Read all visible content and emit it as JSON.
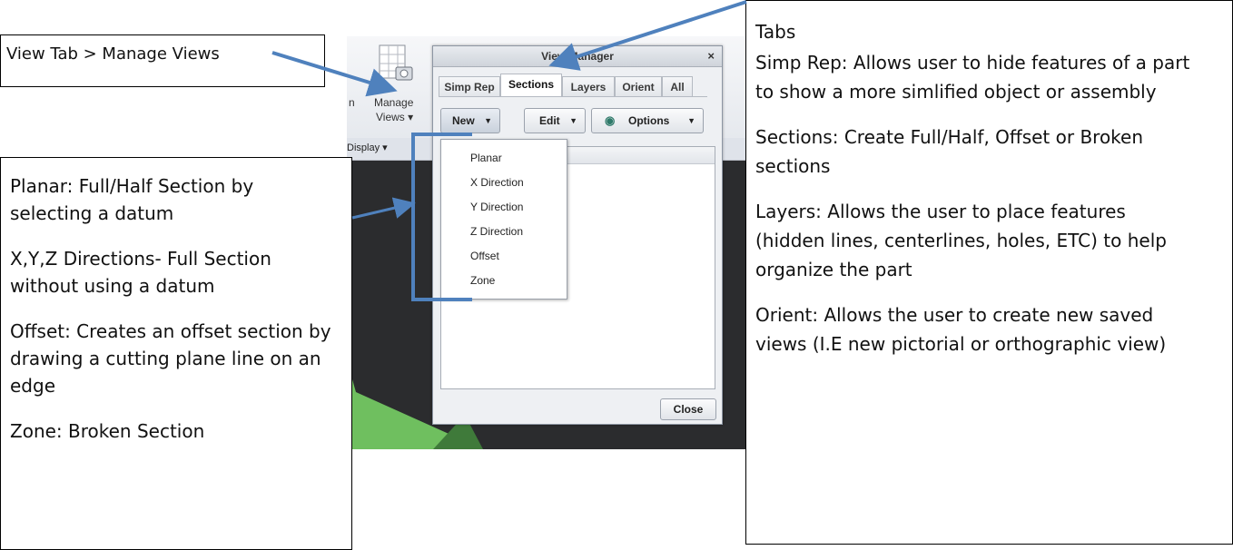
{
  "ribbon": {
    "manage_views_line1": "Manage",
    "manage_views_line2": "Views ▾",
    "partial_left_text": "n",
    "display_label": "Display ▾"
  },
  "view_manager": {
    "title": "View Manager",
    "close_glyph": "×",
    "tabs": [
      "Simp Rep",
      "Sections",
      "Layers",
      "Orient",
      "All"
    ],
    "active_tab": "Sections",
    "buttons": {
      "new": "New",
      "edit": "Edit",
      "options": "Options"
    },
    "close_button": "Close"
  },
  "new_menu": {
    "items": [
      "Planar",
      "X Direction",
      "Y Direction",
      "Z Direction",
      "Offset",
      "Zone"
    ]
  },
  "callouts": {
    "top_left": "View Tab > Manage Views",
    "left": {
      "p1": "Planar: Full/Half Section by selecting a datum",
      "p2": "X,Y,Z Directions- Full Section without using a datum",
      "p3": "Offset: Creates an offset section by drawing a cutting plane line on an edge",
      "p4": "Zone: Broken Section"
    },
    "right": {
      "heading": "Tabs",
      "p1": "Simp Rep: Allows user to hide features of a part to show a more simlified object or assembly",
      "p2": "Sections: Create Full/Half, Offset or Broken sections",
      "p3": "Layers: Allows the user to place features (hidden lines, centerlines, holes, ETC) to help organize the part",
      "p4": "Orient: Allows the user to create new saved views (I.E new pictorial or orthographic view)"
    }
  },
  "colors": {
    "arrow": "#4f81bd",
    "viewport": "#2b2c2e",
    "green_part": "#6fbf5f"
  },
  "icons": [
    "eye-icon",
    "manage-views-icon",
    "dropdown-arrow-icon",
    "close-icon"
  ]
}
